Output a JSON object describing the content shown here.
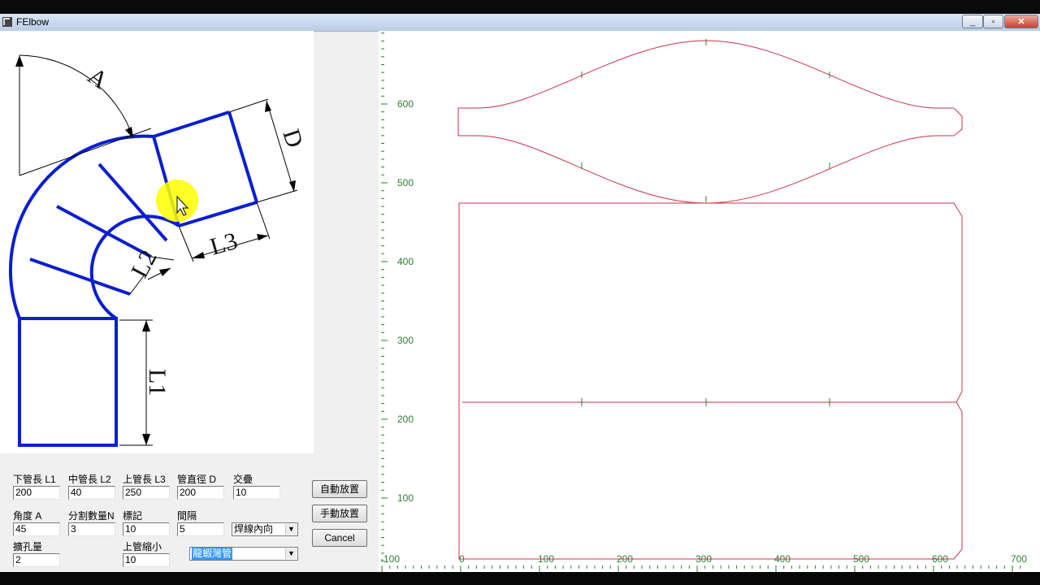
{
  "window": {
    "title": "FElbow",
    "min": "_",
    "max": "▫",
    "close": "✕"
  },
  "diagram_labels": {
    "angle": "A",
    "diameter": "D",
    "l1": "L1",
    "l2": "L2",
    "l3": "L3"
  },
  "form": {
    "l1": {
      "label": "下管長 L1",
      "value": "200"
    },
    "l2": {
      "label": "中管長 L2",
      "value": "40"
    },
    "l3": {
      "label": "上管長 L3",
      "value": "250"
    },
    "d": {
      "label": "管直徑 D",
      "value": "200"
    },
    "overlap": {
      "label": "交疊",
      "value": "10"
    },
    "angle": {
      "label": "角度 A",
      "value": "45"
    },
    "segments": {
      "label": "分割數量N",
      "value": "3"
    },
    "mark": {
      "label": "標記",
      "value": "10"
    },
    "spacing": {
      "label": "間隔",
      "value": "5"
    },
    "weld": {
      "selected": "焊線內向"
    },
    "expand": {
      "label": "擴孔量",
      "value": "2"
    },
    "top_shrink": {
      "label": "上管縮小",
      "value": "10"
    },
    "pipe_type": {
      "selected": "龍蝦灣管"
    },
    "buttons": {
      "auto": "自動放置",
      "manual": "手動放置",
      "cancel": "Cancel"
    }
  },
  "axes": {
    "x_ticks": [
      "-100",
      "0",
      "100",
      "200",
      "300",
      "400",
      "500",
      "600",
      "700"
    ],
    "y_ticks": [
      "100",
      "200",
      "300",
      "400",
      "500",
      "600"
    ]
  },
  "colors": {
    "pattern": "#cc3344",
    "axis": "#2e7d32",
    "elbow": "#0a1fd1"
  }
}
